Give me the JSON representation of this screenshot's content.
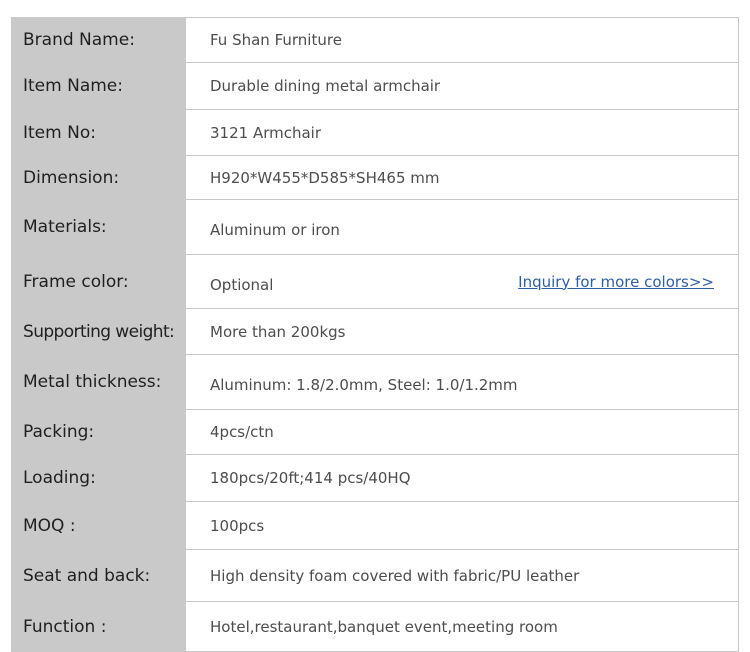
{
  "specs": [
    {
      "label": "Brand Name:",
      "value": "Fu Shan Furniture"
    },
    {
      "label": "Item Name:",
      "value": "Durable dining metal armchair"
    },
    {
      "label": "Item No:",
      "value": "3121 Armchair"
    },
    {
      "label": "Dimension:",
      "value": "H920*W455*D585*SH465 mm"
    },
    {
      "label": "Materials:",
      "value": "Aluminum or iron"
    },
    {
      "label": "Frame color:",
      "value": "Optional",
      "link": "Inquiry for more colors>>"
    },
    {
      "label": "Supporting weight:",
      "value": "More than 200kgs"
    },
    {
      "label": "Metal thickness:",
      "value": "Aluminum: 1.8/2.0mm, Steel: 1.0/1.2mm"
    },
    {
      "label": "Packing:",
      "value": "4pcs/ctn"
    },
    {
      "label": "Loading:",
      "value": "180pcs/20ft;414 pcs/40HQ"
    },
    {
      "label": "MOQ :",
      "value": "100pcs"
    },
    {
      "label": "Seat and back:",
      "value": "High density foam covered with fabric/PU leather"
    },
    {
      "label": "Function :",
      "value": "Hotel,restaurant,banquet event,meeting room"
    }
  ]
}
